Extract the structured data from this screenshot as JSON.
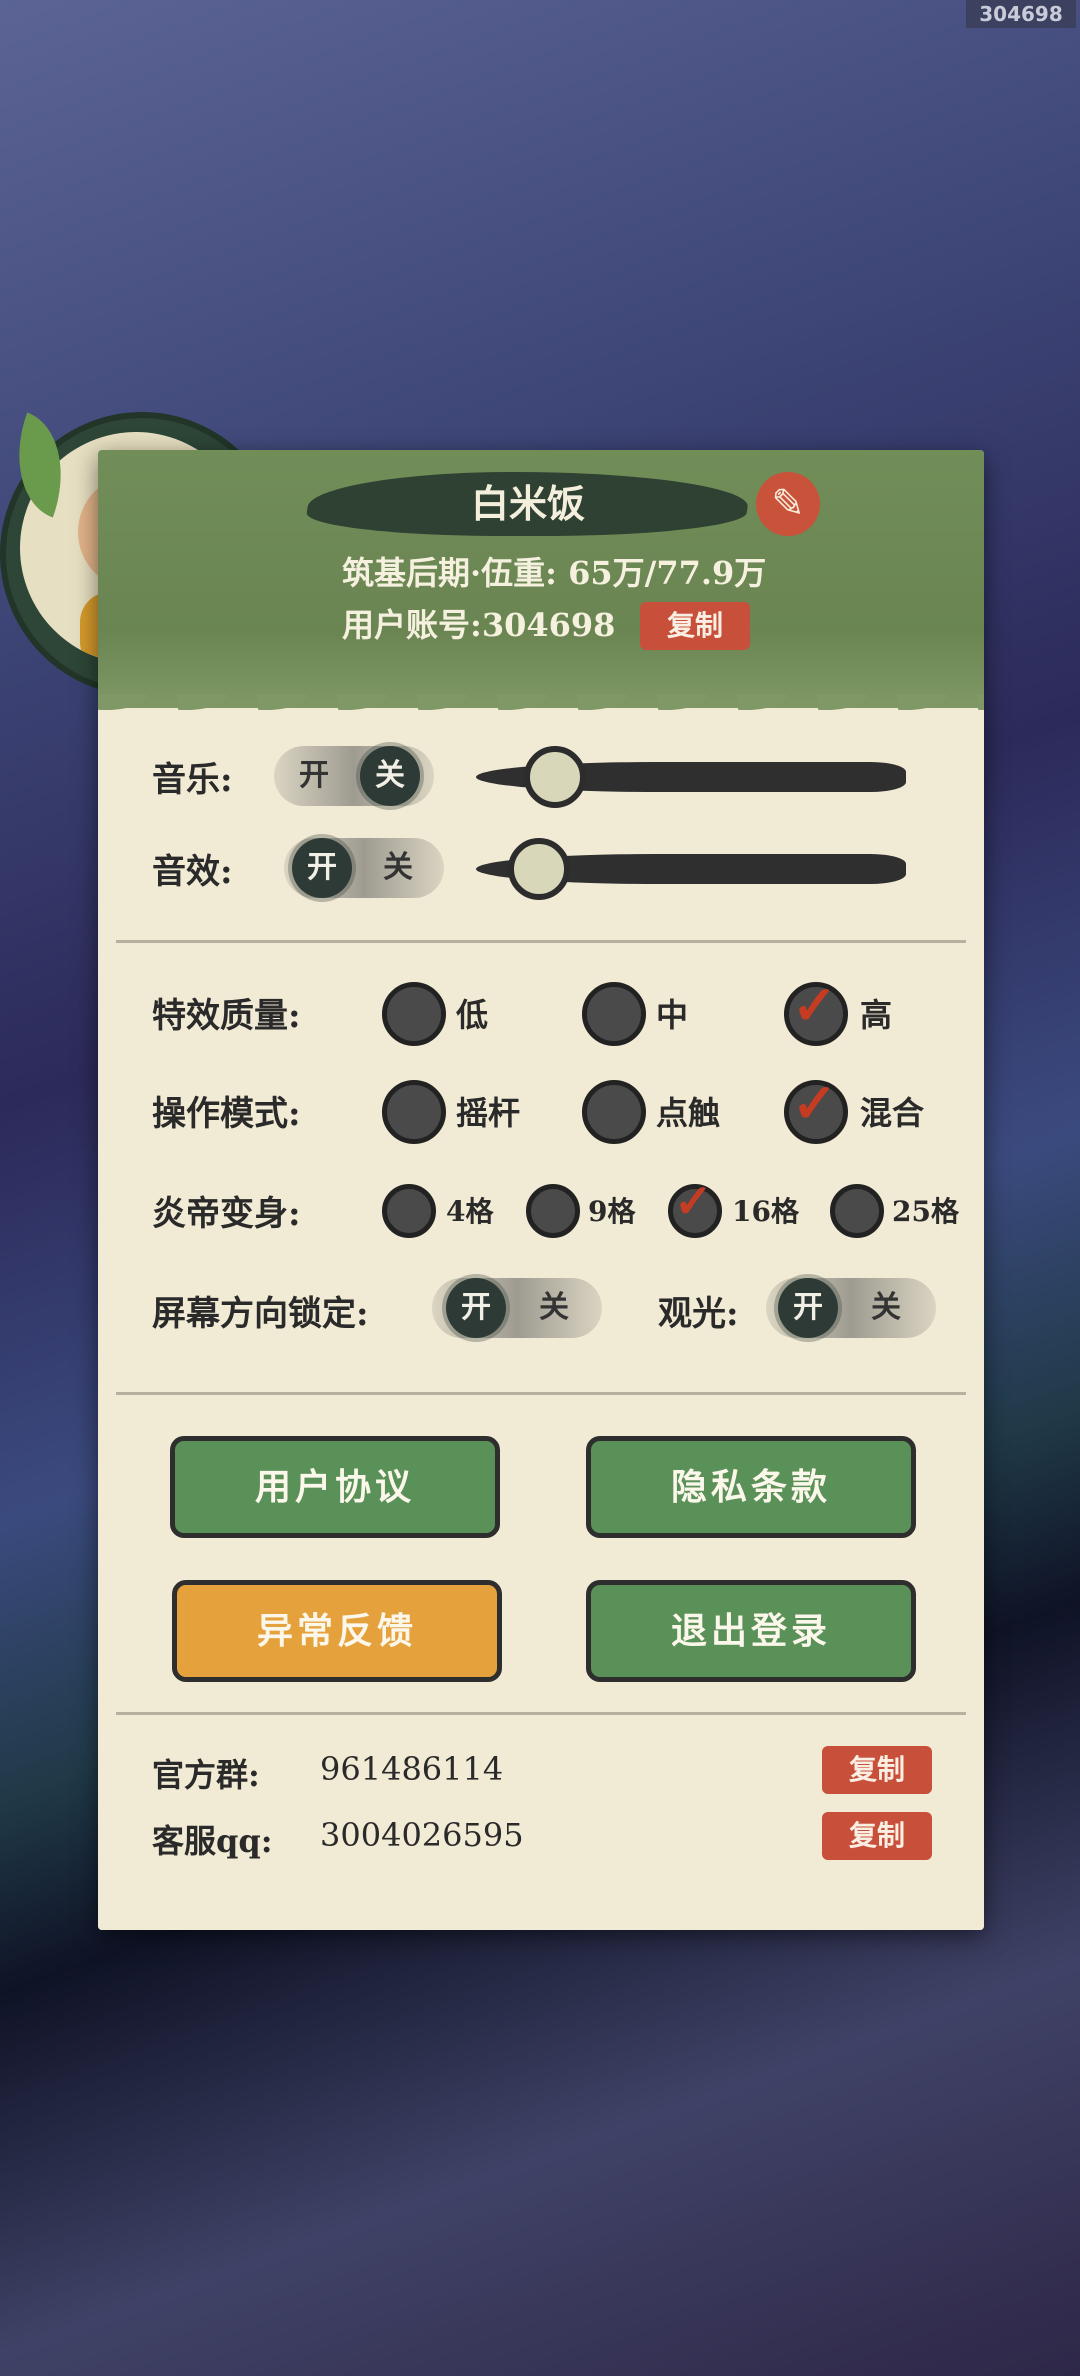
{
  "watermark": "304698",
  "profile": {
    "name": "白米饭",
    "realm": "筑基后期·伍重: 65万/77.9万",
    "account_label": "用户账号:304698",
    "copy_label": "复制"
  },
  "settings": {
    "music_label": "音乐:",
    "sfx_label": "音效:",
    "on": "开",
    "off": "关",
    "effect_quality_label": "特效质量:",
    "quality_options": [
      "低",
      "中",
      "高"
    ],
    "control_mode_label": "操作模式:",
    "control_options": [
      "摇杆",
      "点触",
      "混合"
    ],
    "transform_label": "炎帝变身:",
    "transform_options": [
      "4格",
      "9格",
      "16格",
      "25格"
    ],
    "orientation_lock_label": "屏幕方向锁定:",
    "sightseeing_label": "观光:"
  },
  "buttons": {
    "user_agreement": "用户协议",
    "privacy": "隐私条款",
    "feedback": "异常反馈",
    "logout": "退出登录"
  },
  "info": {
    "group_label": "官方群:",
    "group_value": "961486114",
    "service_label": "客服qq:",
    "service_value": "3004026595",
    "copy_label": "复制"
  }
}
